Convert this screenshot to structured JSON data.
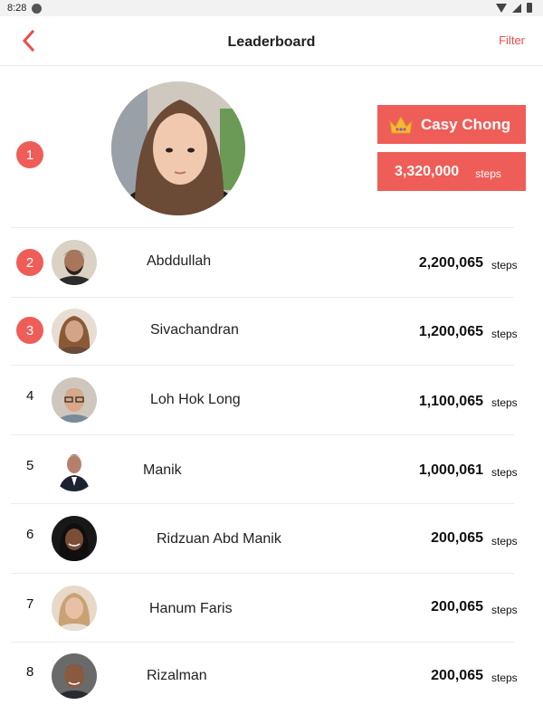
{
  "status_bar": {
    "time": "8:28"
  },
  "app_bar": {
    "title": "Leaderboard",
    "filter_label": "Filter"
  },
  "winner": {
    "rank": "1",
    "name": "Casy Chong",
    "steps": "3,320,000",
    "unit": "steps"
  },
  "rows": [
    {
      "rank": "2",
      "name": "Abddullah",
      "steps": "2,200,065",
      "unit": "steps",
      "badge": true
    },
    {
      "rank": "3",
      "name": "Sivachandran",
      "steps": "1,200,065",
      "unit": "steps",
      "badge": true
    },
    {
      "rank": "4",
      "name": "Loh Hok Long",
      "steps": "1,100,065",
      "unit": "steps",
      "badge": false
    },
    {
      "rank": "5",
      "name": "Manik",
      "steps": "1,000,061",
      "unit": "steps",
      "badge": false
    },
    {
      "rank": "6",
      "name": "Ridzuan Abd Manik",
      "steps": "200,065",
      "unit": "steps",
      "badge": false
    },
    {
      "rank": "7",
      "name": "Hanum Faris",
      "steps": "200,065",
      "unit": "steps",
      "badge": false
    },
    {
      "rank": "8",
      "name": "Rizalman",
      "steps": "200,065",
      "unit": "steps",
      "badge": false
    }
  ],
  "colors": {
    "accent": "#ef5d58",
    "filter": "#ef4b4b",
    "crown": "#f5b83d"
  },
  "icons": {
    "back": "back-arrow-icon",
    "crown": "crown-icon"
  }
}
